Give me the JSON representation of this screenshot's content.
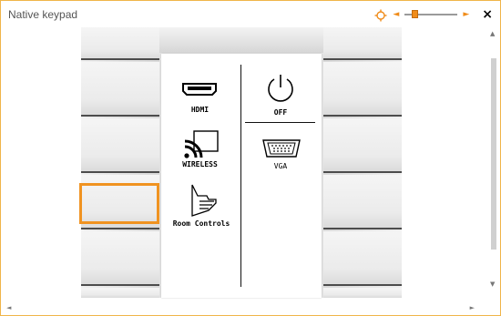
{
  "window": {
    "title": "Native keypad",
    "close_label": "×"
  },
  "zoom": {
    "level": 0.15
  },
  "keypad": {
    "selected_key": "left-3",
    "buttons_left": [
      {
        "label": "HDMI",
        "icon": "hdmi-icon"
      },
      {
        "label": "WIRELESS",
        "icon": "wireless-icon"
      },
      {
        "label": "Room Controls",
        "icon": "hand-pointer-icon"
      }
    ],
    "buttons_right": [
      {
        "label": "OFF",
        "icon": "power-icon"
      },
      {
        "label": "VGA",
        "icon": "vga-icon"
      }
    ]
  },
  "colors": {
    "accent": "#f09321",
    "window_border": "#f0b54a"
  }
}
